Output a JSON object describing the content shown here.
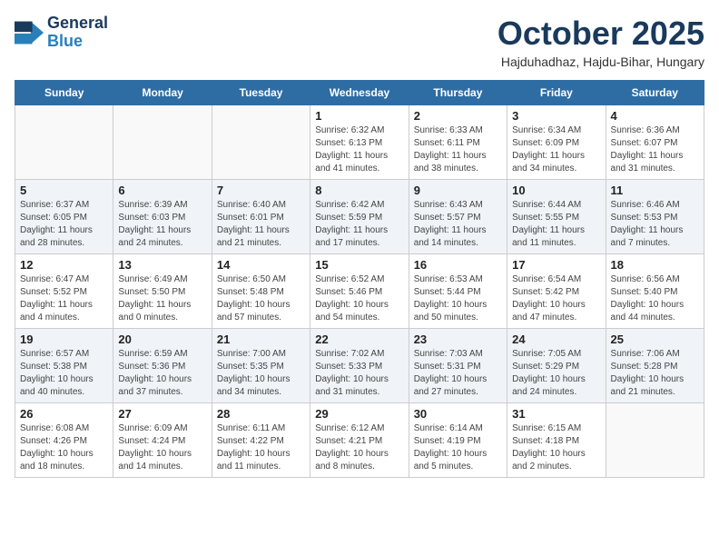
{
  "header": {
    "logo_line1": "General",
    "logo_line2": "Blue",
    "month": "October 2025",
    "location": "Hajduhadhaz, Hajdu-Bihar, Hungary"
  },
  "days_of_week": [
    "Sunday",
    "Monday",
    "Tuesday",
    "Wednesday",
    "Thursday",
    "Friday",
    "Saturday"
  ],
  "weeks": [
    [
      {
        "day": "",
        "info": ""
      },
      {
        "day": "",
        "info": ""
      },
      {
        "day": "",
        "info": ""
      },
      {
        "day": "1",
        "info": "Sunrise: 6:32 AM\nSunset: 6:13 PM\nDaylight: 11 hours\nand 41 minutes."
      },
      {
        "day": "2",
        "info": "Sunrise: 6:33 AM\nSunset: 6:11 PM\nDaylight: 11 hours\nand 38 minutes."
      },
      {
        "day": "3",
        "info": "Sunrise: 6:34 AM\nSunset: 6:09 PM\nDaylight: 11 hours\nand 34 minutes."
      },
      {
        "day": "4",
        "info": "Sunrise: 6:36 AM\nSunset: 6:07 PM\nDaylight: 11 hours\nand 31 minutes."
      }
    ],
    [
      {
        "day": "5",
        "info": "Sunrise: 6:37 AM\nSunset: 6:05 PM\nDaylight: 11 hours\nand 28 minutes."
      },
      {
        "day": "6",
        "info": "Sunrise: 6:39 AM\nSunset: 6:03 PM\nDaylight: 11 hours\nand 24 minutes."
      },
      {
        "day": "7",
        "info": "Sunrise: 6:40 AM\nSunset: 6:01 PM\nDaylight: 11 hours\nand 21 minutes."
      },
      {
        "day": "8",
        "info": "Sunrise: 6:42 AM\nSunset: 5:59 PM\nDaylight: 11 hours\nand 17 minutes."
      },
      {
        "day": "9",
        "info": "Sunrise: 6:43 AM\nSunset: 5:57 PM\nDaylight: 11 hours\nand 14 minutes."
      },
      {
        "day": "10",
        "info": "Sunrise: 6:44 AM\nSunset: 5:55 PM\nDaylight: 11 hours\nand 11 minutes."
      },
      {
        "day": "11",
        "info": "Sunrise: 6:46 AM\nSunset: 5:53 PM\nDaylight: 11 hours\nand 7 minutes."
      }
    ],
    [
      {
        "day": "12",
        "info": "Sunrise: 6:47 AM\nSunset: 5:52 PM\nDaylight: 11 hours\nand 4 minutes."
      },
      {
        "day": "13",
        "info": "Sunrise: 6:49 AM\nSunset: 5:50 PM\nDaylight: 11 hours\nand 0 minutes."
      },
      {
        "day": "14",
        "info": "Sunrise: 6:50 AM\nSunset: 5:48 PM\nDaylight: 10 hours\nand 57 minutes."
      },
      {
        "day": "15",
        "info": "Sunrise: 6:52 AM\nSunset: 5:46 PM\nDaylight: 10 hours\nand 54 minutes."
      },
      {
        "day": "16",
        "info": "Sunrise: 6:53 AM\nSunset: 5:44 PM\nDaylight: 10 hours\nand 50 minutes."
      },
      {
        "day": "17",
        "info": "Sunrise: 6:54 AM\nSunset: 5:42 PM\nDaylight: 10 hours\nand 47 minutes."
      },
      {
        "day": "18",
        "info": "Sunrise: 6:56 AM\nSunset: 5:40 PM\nDaylight: 10 hours\nand 44 minutes."
      }
    ],
    [
      {
        "day": "19",
        "info": "Sunrise: 6:57 AM\nSunset: 5:38 PM\nDaylight: 10 hours\nand 40 minutes."
      },
      {
        "day": "20",
        "info": "Sunrise: 6:59 AM\nSunset: 5:36 PM\nDaylight: 10 hours\nand 37 minutes."
      },
      {
        "day": "21",
        "info": "Sunrise: 7:00 AM\nSunset: 5:35 PM\nDaylight: 10 hours\nand 34 minutes."
      },
      {
        "day": "22",
        "info": "Sunrise: 7:02 AM\nSunset: 5:33 PM\nDaylight: 10 hours\nand 31 minutes."
      },
      {
        "day": "23",
        "info": "Sunrise: 7:03 AM\nSunset: 5:31 PM\nDaylight: 10 hours\nand 27 minutes."
      },
      {
        "day": "24",
        "info": "Sunrise: 7:05 AM\nSunset: 5:29 PM\nDaylight: 10 hours\nand 24 minutes."
      },
      {
        "day": "25",
        "info": "Sunrise: 7:06 AM\nSunset: 5:28 PM\nDaylight: 10 hours\nand 21 minutes."
      }
    ],
    [
      {
        "day": "26",
        "info": "Sunrise: 6:08 AM\nSunset: 4:26 PM\nDaylight: 10 hours\nand 18 minutes."
      },
      {
        "day": "27",
        "info": "Sunrise: 6:09 AM\nSunset: 4:24 PM\nDaylight: 10 hours\nand 14 minutes."
      },
      {
        "day": "28",
        "info": "Sunrise: 6:11 AM\nSunset: 4:22 PM\nDaylight: 10 hours\nand 11 minutes."
      },
      {
        "day": "29",
        "info": "Sunrise: 6:12 AM\nSunset: 4:21 PM\nDaylight: 10 hours\nand 8 minutes."
      },
      {
        "day": "30",
        "info": "Sunrise: 6:14 AM\nSunset: 4:19 PM\nDaylight: 10 hours\nand 5 minutes."
      },
      {
        "day": "31",
        "info": "Sunrise: 6:15 AM\nSunset: 4:18 PM\nDaylight: 10 hours\nand 2 minutes."
      },
      {
        "day": "",
        "info": ""
      }
    ]
  ]
}
